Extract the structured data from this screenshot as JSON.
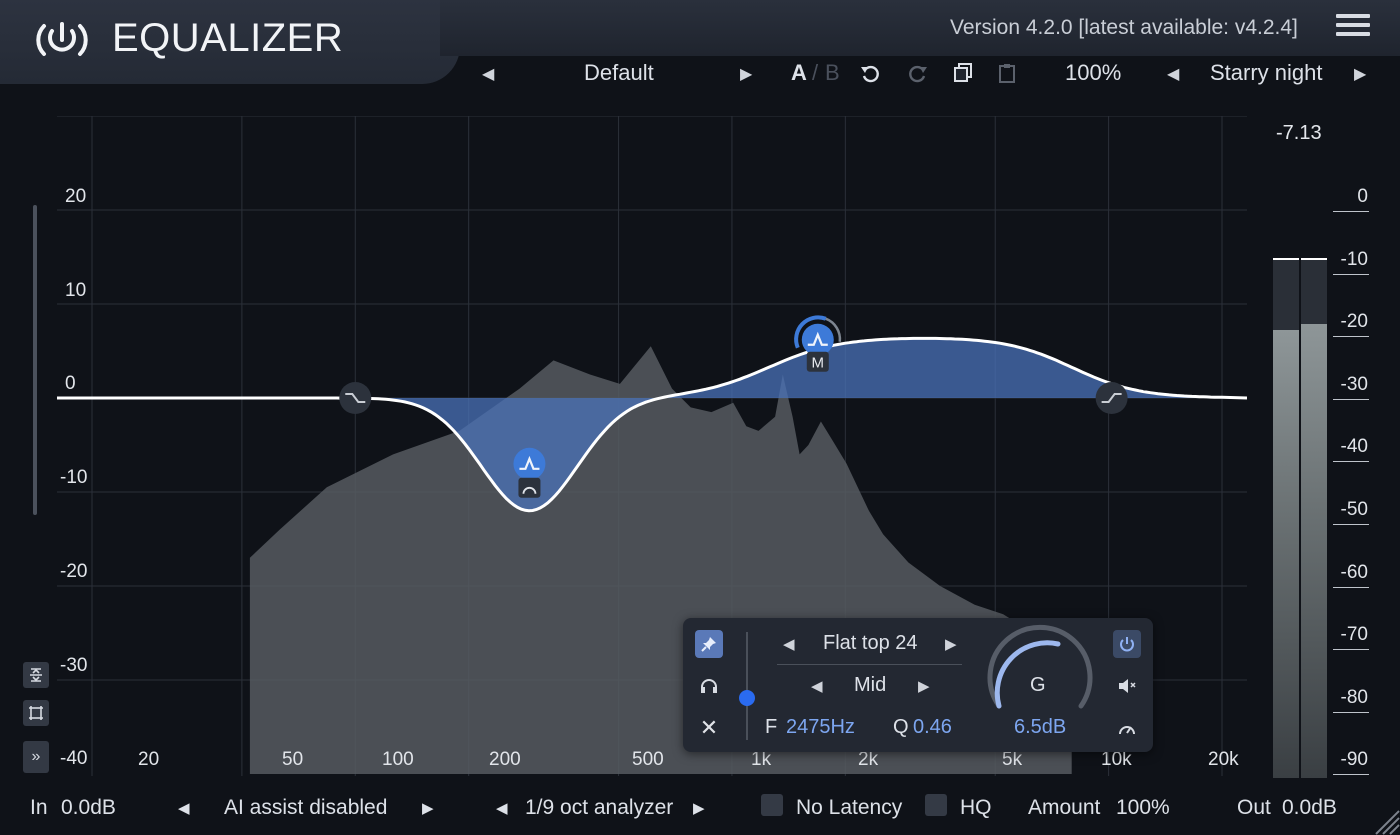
{
  "app": {
    "title": "EQUALIZER",
    "version": "Version 4.2.0 [latest available: v4.2.4]"
  },
  "toolbar": {
    "preset": "Default",
    "a_label": "A",
    "ab_sep": "/",
    "b_label": "B",
    "zoom": "100%",
    "theme": "Starry night"
  },
  "graph": {
    "db_labels": [
      "20",
      "10",
      "0",
      "-10",
      "-20",
      "-30",
      "-40"
    ],
    "freq_labels": [
      "20",
      "50",
      "100",
      "200",
      "500",
      "1k",
      "2k",
      "5k",
      "10k",
      "20k"
    ],
    "colors": {
      "curve": "#ffffff",
      "fill": "#4a72b8",
      "spectrum": "#5a5e63",
      "node": "#3d7ad8"
    },
    "nodes": [
      {
        "type": "low-shelf",
        "freq": "100Hz",
        "gain_db": 0
      },
      {
        "type": "bell",
        "freq": "300Hz",
        "gain_db": -12
      },
      {
        "type": "flat-top",
        "freq": "2475Hz",
        "gain_db": 6.5,
        "badge": "M"
      },
      {
        "type": "high-shelf",
        "freq": "10kHz",
        "gain_db": 0
      }
    ]
  },
  "meter": {
    "peak": "-7.13",
    "scale": [
      "0",
      "-10",
      "-20",
      "-30",
      "-40",
      "-50",
      "-60",
      "-70",
      "-80",
      "-90"
    ],
    "levels_db": [
      -19,
      -18
    ]
  },
  "band": {
    "shape": "Flat top 24",
    "mode": "Mid",
    "freq_label": "F",
    "freq": "2475Hz",
    "q_label": "Q",
    "q": "0.46",
    "gain_label": "G",
    "gain": "6.5dB"
  },
  "footer": {
    "in_label": "In",
    "in_value": "0.0dB",
    "ai": "AI assist disabled",
    "analyzer": "1/9 oct analyzer",
    "latency": "No Latency",
    "hq": "HQ",
    "amount_label": "Amount",
    "amount_value": "100%",
    "out_label": "Out",
    "out_value": "0.0dB"
  }
}
